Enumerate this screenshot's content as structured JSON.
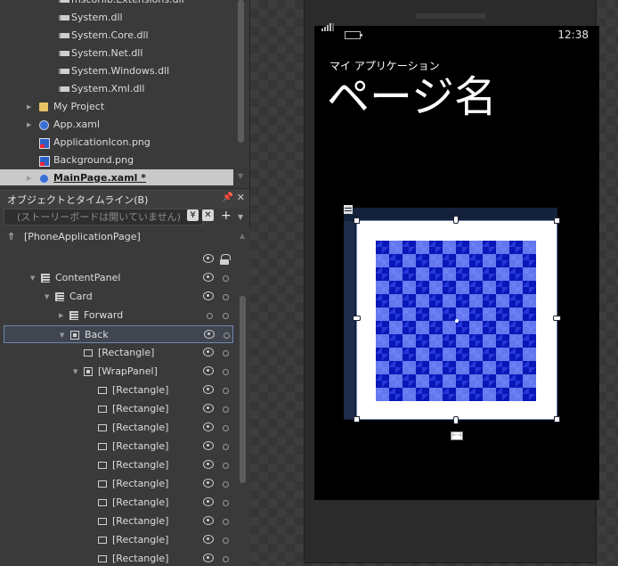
{
  "project": {
    "rows": [
      {
        "label": "mscorlib.Extensions.dll",
        "icon": "dll-icon",
        "indent": 2
      },
      {
        "label": "System.dll",
        "icon": "dll-icon",
        "indent": 2
      },
      {
        "label": "System.Core.dll",
        "icon": "dll-icon",
        "indent": 2
      },
      {
        "label": "System.Net.dll",
        "icon": "dll-icon",
        "indent": 2
      },
      {
        "label": "System.Windows.dll",
        "icon": "dll-icon",
        "indent": 2
      },
      {
        "label": "System.Xml.dll",
        "icon": "dll-icon",
        "indent": 2
      },
      {
        "label": "My Project",
        "icon": "folder-icon",
        "indent": 1,
        "expander": true
      },
      {
        "label": "App.xaml",
        "icon": "xaml-icon",
        "indent": 1,
        "expander": true
      },
      {
        "label": "ApplicationIcon.png",
        "icon": "png-icon",
        "indent": 1
      },
      {
        "label": "Background.png",
        "icon": "png-icon",
        "indent": 1
      },
      {
        "label": "MainPage.xaml *",
        "icon": "xaml-icon",
        "indent": 1,
        "expander": true,
        "selected": true
      }
    ]
  },
  "objects_panel": {
    "title": "オブジェクトとタイムライン(B)",
    "storyboard_placeholder": "(ストーリーボードは開いていません)",
    "root": "[PhoneApplicationPage]",
    "nodes": [
      {
        "label": "ContentPanel",
        "icon": "grid-icon",
        "level": 1,
        "expander": "down"
      },
      {
        "label": "Card",
        "icon": "grid-icon",
        "level": 2,
        "expander": "down"
      },
      {
        "label": "Forward",
        "icon": "grid-icon",
        "level": 3,
        "expander": "right",
        "hidden": true
      },
      {
        "label": "Back",
        "icon": "canvas-icon",
        "level": 3,
        "expander": "down",
        "selected": true
      },
      {
        "label": "[Rectangle]",
        "icon": "rectangle-icon",
        "level": 4
      },
      {
        "label": "[WrapPanel]",
        "icon": "wrappanel-icon",
        "level": 4,
        "expander": "down"
      },
      {
        "label": "[Rectangle]",
        "icon": "rectangle-icon",
        "level": 5
      },
      {
        "label": "[Rectangle]",
        "icon": "rectangle-icon",
        "level": 5
      },
      {
        "label": "[Rectangle]",
        "icon": "rectangle-icon",
        "level": 5
      },
      {
        "label": "[Rectangle]",
        "icon": "rectangle-icon",
        "level": 5
      },
      {
        "label": "[Rectangle]",
        "icon": "rectangle-icon",
        "level": 5
      },
      {
        "label": "[Rectangle]",
        "icon": "rectangle-icon",
        "level": 5
      },
      {
        "label": "[Rectangle]",
        "icon": "rectangle-icon",
        "level": 5
      },
      {
        "label": "[Rectangle]",
        "icon": "rectangle-icon",
        "level": 5
      },
      {
        "label": "[Rectangle]",
        "icon": "rectangle-icon",
        "level": 5
      },
      {
        "label": "[Rectangle]",
        "icon": "rectangle-icon",
        "level": 5
      }
    ]
  },
  "phone": {
    "time": "12:38",
    "app_title": "マイ アプリケーション",
    "page_title": "ページ名"
  },
  "colors": {
    "pattern_dark": "#0a17b8",
    "pattern_light": "#8296ff",
    "selection_border": "#6d85b0"
  }
}
